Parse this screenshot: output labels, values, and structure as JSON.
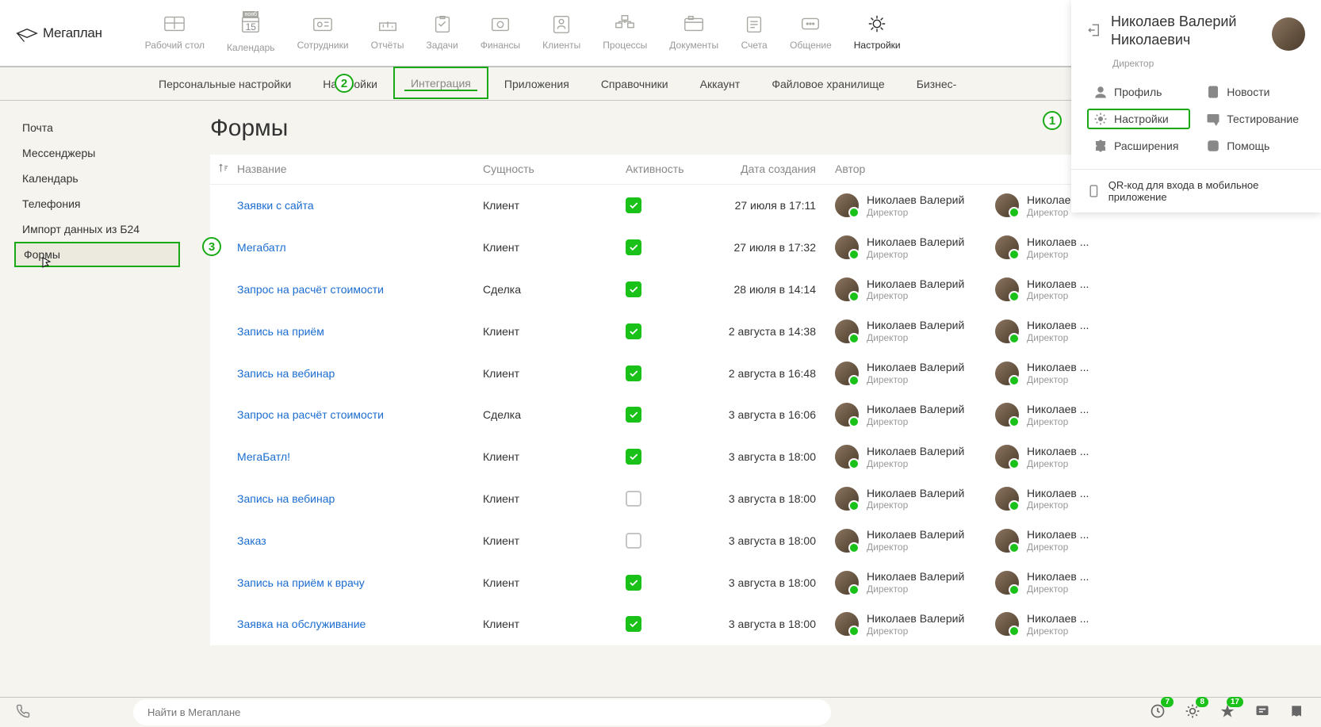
{
  "logo": "Мегаплан",
  "topnav": [
    {
      "label": "Рабочий стол"
    },
    {
      "label": "Календарь",
      "badge": "нояб",
      "day": "15"
    },
    {
      "label": "Сотрудники"
    },
    {
      "label": "Отчёты"
    },
    {
      "label": "Задачи"
    },
    {
      "label": "Финансы"
    },
    {
      "label": "Клиенты"
    },
    {
      "label": "Процессы"
    },
    {
      "label": "Документы"
    },
    {
      "label": "Счета"
    },
    {
      "label": "Общение"
    },
    {
      "label": "Настройки"
    }
  ],
  "subnav": [
    {
      "label": "Персональные настройки"
    },
    {
      "label": "Настройки"
    },
    {
      "label": "Интеграция"
    },
    {
      "label": "Приложения"
    },
    {
      "label": "Справочники"
    },
    {
      "label": "Аккаунт"
    },
    {
      "label": "Файловое хранилище"
    },
    {
      "label": "Бизнес-"
    }
  ],
  "sidebar": [
    {
      "label": "Почта"
    },
    {
      "label": "Мессенджеры"
    },
    {
      "label": "Календарь"
    },
    {
      "label": "Телефония"
    },
    {
      "label": "Импорт данных из Б24"
    },
    {
      "label": "Формы"
    }
  ],
  "page_title": "Формы",
  "columns": {
    "name": "Название",
    "entity": "Сущность",
    "activity": "Активность",
    "date": "Дата создания",
    "author": "Автор"
  },
  "author_default": {
    "name": "Николаев Валерий",
    "role": "Директор"
  },
  "author_trunc": {
    "name": "Николаев ...",
    "role": "Директор"
  },
  "rows": [
    {
      "name": "Заявки с сайта",
      "entity": "Клиент",
      "active": true,
      "date": "27 июля в 17:11"
    },
    {
      "name": "Мегабатл",
      "entity": "Клиент",
      "active": true,
      "date": "27 июля в 17:32"
    },
    {
      "name": "Запрос на расчёт стоимости",
      "entity": "Сделка",
      "active": true,
      "date": "28 июля в 14:14"
    },
    {
      "name": "Запись на приём",
      "entity": "Клиент",
      "active": true,
      "date": "2 августа в 14:38"
    },
    {
      "name": "Запись на вебинар",
      "entity": "Клиент",
      "active": true,
      "date": "2 августа в 16:48"
    },
    {
      "name": "Запрос на расчёт стоимости",
      "entity": "Сделка",
      "active": true,
      "date": "3 августа в 16:06"
    },
    {
      "name": "МегаБатл!",
      "entity": "Клиент",
      "active": true,
      "date": "3 августа в 18:00"
    },
    {
      "name": "Запись на вебинар",
      "entity": "Клиент",
      "active": false,
      "date": "3 августа в 18:00"
    },
    {
      "name": "Заказ",
      "entity": "Клиент",
      "active": false,
      "date": "3 августа в 18:00"
    },
    {
      "name": "Запись на приём к врачу",
      "entity": "Клиент",
      "active": true,
      "date": "3 августа в 18:00"
    },
    {
      "name": "Заявка на обслуживание",
      "entity": "Клиент",
      "active": true,
      "date": "3 августа в 18:00"
    }
  ],
  "profile": {
    "name": "Николаев Валерий Николаевич",
    "role": "Директор",
    "menu": [
      {
        "label": "Профиль",
        "icon": "person"
      },
      {
        "label": "Новости",
        "icon": "clipboard"
      },
      {
        "label": "Настройки",
        "icon": "gear",
        "highlighted": true
      },
      {
        "label": "Тестирование",
        "icon": "diploma"
      },
      {
        "label": "Расширения",
        "icon": "puzzle"
      },
      {
        "label": "Помощь",
        "icon": "question"
      }
    ],
    "qr": "QR-код для входа в мобильное приложение"
  },
  "callouts": {
    "one": "1",
    "two": "2",
    "three": "3"
  },
  "footer": {
    "search_placeholder": "Найти в Мегаплане",
    "badges": {
      "clock": "7",
      "help": "8",
      "star": "17"
    }
  }
}
